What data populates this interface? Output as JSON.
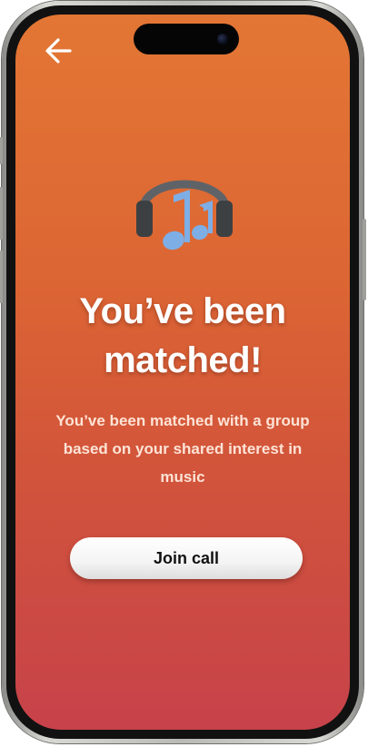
{
  "header": {
    "back_icon": "arrow-left-icon"
  },
  "hero": {
    "icon": "headphones-music-icon",
    "title_line1": "You’ve been",
    "title_line2": "matched!",
    "subtitle_line1": "You’ve been matched with a group",
    "subtitle_line2": "based on your shared interest in",
    "subtitle_line3": "music"
  },
  "actions": {
    "join_label": "Join call"
  },
  "colors": {
    "gradient_top": "#e37634",
    "gradient_bottom": "#c7424a",
    "headphone_band": "#5f6368",
    "music_note": "#7eaee6",
    "button_bg": "#ffffff",
    "text_primary": "#ffffff",
    "text_secondary": "#fde3d6"
  }
}
